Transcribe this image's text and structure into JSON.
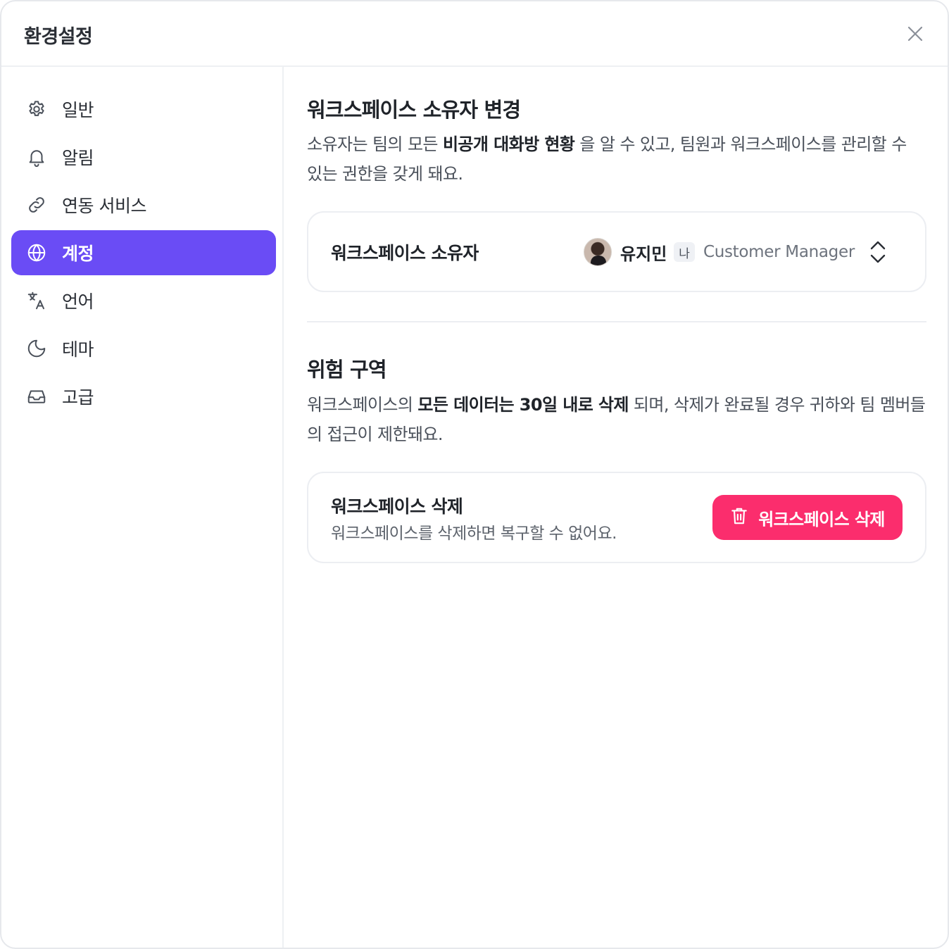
{
  "header": {
    "title": "환경설정",
    "close_icon": "close-icon"
  },
  "sidebar": {
    "items": [
      {
        "label": "일반",
        "icon": "gear-icon",
        "active": false
      },
      {
        "label": "알림",
        "icon": "bell-icon",
        "active": false
      },
      {
        "label": "연동 서비스",
        "icon": "link-icon",
        "active": false
      },
      {
        "label": "계정",
        "icon": "globe-icon",
        "active": true
      },
      {
        "label": "언어",
        "icon": "translate-icon",
        "active": false
      },
      {
        "label": "테마",
        "icon": "moon-icon",
        "active": false
      },
      {
        "label": "고급",
        "icon": "inbox-icon",
        "active": false
      }
    ],
    "active_color": "#6a4cf5"
  },
  "owner_section": {
    "title": "워크스페이스 소유자 변경",
    "desc_part1": "소유자는 팀의 모든 ",
    "desc_bold": "비공개 대화방 현황",
    "desc_part2": " 을 알 수 있고, 팀원과 워크스페이스를 관리할 수 있는 권한을 갖게 돼요.",
    "card": {
      "label": "워크스페이스 소유자",
      "owner_name": "유지민",
      "me_badge": "나",
      "owner_role": "Customer Manager",
      "chevron_icon": "chevron-up-down-icon"
    }
  },
  "danger_section": {
    "title": "위험 구역",
    "desc_part1": "워크스페이스의 ",
    "desc_bold": "모든 데이터는 30일 내로 삭제",
    "desc_part2": " 되며, 삭제가 완료될 경우 귀하와 팀 멤버들의 접근이 제한돼요.",
    "card": {
      "label": "워크스페이스 삭제",
      "sublabel": "워크스페이스를 삭제하면 복구할 수 없어요.",
      "button_label": "워크스페이스 삭제",
      "button_icon": "trash-icon",
      "button_color": "#fb2d6d"
    }
  }
}
